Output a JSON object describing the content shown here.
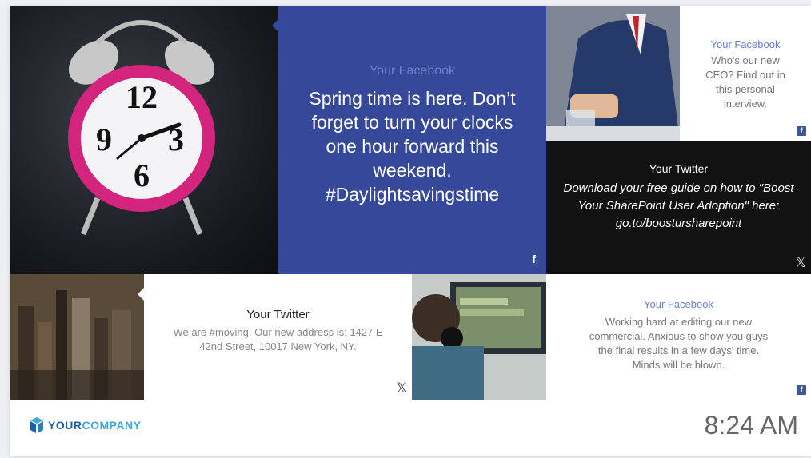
{
  "tiles": {
    "blue_post": {
      "source": "Your Facebook",
      "message": "Spring time is here. Don’t forget to turn your clocks one hour forward this weekend. #Daylightsavingstime",
      "icon": "f"
    },
    "ceo_post": {
      "source": "Your Facebook",
      "message": "Who's our new CEO? Find out in this personal interview."
    },
    "twitter_guide": {
      "source": "Your Twitter",
      "message": "Download your free guide on how to \"Boost Your SharePoint User Adoption\" here: go.to/boostursharepoint"
    },
    "twitter_moving": {
      "source": "Your Twitter",
      "message": "We are #moving. Our new address is: 1427 E 42nd Street, 10017 New York, NY."
    },
    "fb_commercial": {
      "source": "Your Facebook",
      "message": "Working hard at editing our new commercial. Anxious to show you guys the final results in a few days' time. Minds will be blown."
    }
  },
  "footer": {
    "logo_bold": "YOUR",
    "logo_light": "COMPANY",
    "time": "8:24 AM"
  },
  "clock_numbers": [
    "12",
    "3",
    "6",
    "9"
  ],
  "colors": {
    "facebook_blue": "#35489a",
    "twitter_black": "#121212",
    "logo_dark": "#1f5fa8",
    "logo_light": "#3ba8d8"
  }
}
